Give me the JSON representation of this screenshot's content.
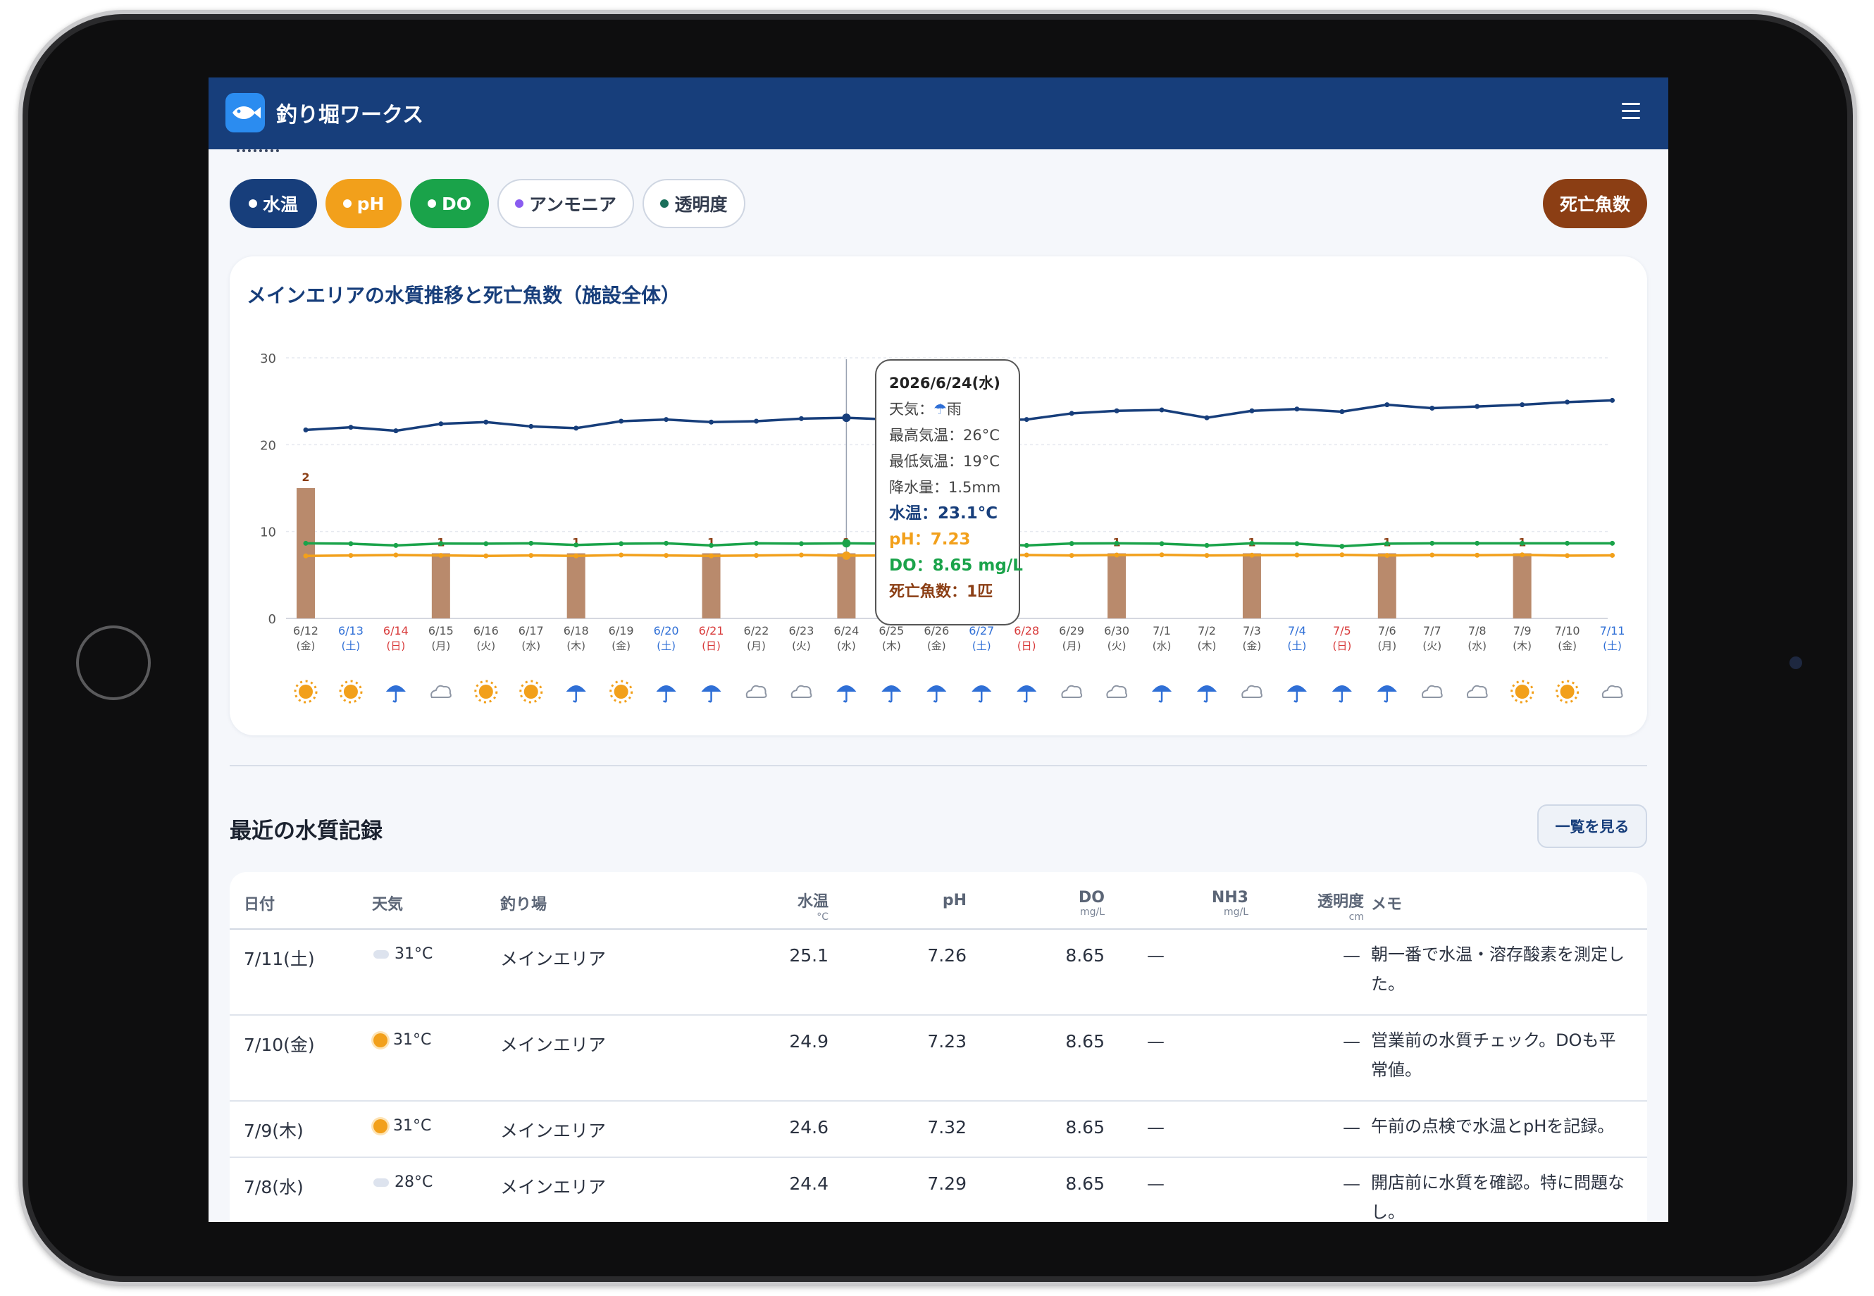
{
  "app": {
    "title": "釣り堀ワークス"
  },
  "chips": {
    "temp": "水温",
    "ph": "pH",
    "do": "DO",
    "nh3": "アンモニア",
    "clarity": "透明度",
    "dead": "死亡魚数"
  },
  "chart_card": {
    "title": "メインエリアの水質推移と死亡魚数（施設全体）"
  },
  "colors": {
    "temp": "#173e7b",
    "ph": "#f2a01b",
    "do": "#1aa34a",
    "dead": "#b98a6c",
    "dead_label": "#8b3e14",
    "saturday": "#2f6fd6",
    "sunday": "#d83a3a",
    "rain": "#2f6fd6",
    "sun": "#f2a01b"
  },
  "chart_data": {
    "type": "line",
    "title": "メインエリアの水質推移と死亡魚数（施設全体）",
    "ylim": [
      0,
      30
    ],
    "yticks": [
      0,
      10,
      20,
      30
    ],
    "grid": true,
    "categories": [
      "6/12",
      "6/13",
      "6/14",
      "6/15",
      "6/16",
      "6/17",
      "6/18",
      "6/19",
      "6/20",
      "6/21",
      "6/22",
      "6/23",
      "6/24",
      "6/25",
      "6/26",
      "6/27",
      "6/28",
      "6/29",
      "6/30",
      "7/1",
      "7/2",
      "7/3",
      "7/4",
      "7/5",
      "7/6",
      "7/7",
      "7/8",
      "7/9",
      "7/10",
      "7/11"
    ],
    "weekdays": [
      "(金)",
      "(土)",
      "(日)",
      "(月)",
      "(火)",
      "(水)",
      "(木)",
      "(金)",
      "(土)",
      "(日)",
      "(月)",
      "(火)",
      "(水)",
      "(木)",
      "(金)",
      "(土)",
      "(日)",
      "(月)",
      "(火)",
      "(水)",
      "(木)",
      "(金)",
      "(土)",
      "(日)",
      "(月)",
      "(火)",
      "(水)",
      "(木)",
      "(金)",
      "(土)"
    ],
    "weather": [
      "sun",
      "sun",
      "rain",
      "cloud",
      "sun",
      "sun",
      "rain",
      "sun",
      "rain",
      "rain",
      "cloud",
      "cloud",
      "rain",
      "rain",
      "rain",
      "rain",
      "rain",
      "cloud",
      "cloud",
      "rain",
      "rain",
      "cloud",
      "rain",
      "rain",
      "rain",
      "cloud",
      "cloud",
      "sun",
      "sun",
      "cloud"
    ],
    "series": [
      {
        "name": "水温",
        "type": "line",
        "values": [
          21.7,
          22.0,
          21.6,
          22.4,
          22.6,
          22.1,
          21.9,
          22.7,
          22.9,
          22.6,
          22.7,
          23.0,
          23.1,
          22.9,
          23.0,
          22.8,
          22.9,
          23.6,
          23.9,
          24.0,
          23.1,
          23.9,
          24.1,
          23.8,
          24.6,
          24.2,
          24.4,
          24.6,
          24.9,
          25.1
        ]
      },
      {
        "name": "DO",
        "type": "line",
        "values": [
          8.65,
          8.6,
          8.4,
          8.62,
          8.6,
          8.65,
          8.45,
          8.6,
          8.65,
          8.4,
          8.65,
          8.6,
          8.65,
          8.6,
          8.65,
          8.62,
          8.4,
          8.62,
          8.65,
          8.6,
          8.4,
          8.65,
          8.6,
          8.3,
          8.6,
          8.65,
          8.65,
          8.65,
          8.65,
          8.65
        ]
      },
      {
        "name": "pH",
        "type": "line",
        "values": [
          7.2,
          7.25,
          7.3,
          7.25,
          7.2,
          7.25,
          7.2,
          7.3,
          7.25,
          7.2,
          7.25,
          7.3,
          7.23,
          7.25,
          7.2,
          7.25,
          7.3,
          7.25,
          7.3,
          7.32,
          7.25,
          7.28,
          7.3,
          7.32,
          7.25,
          7.3,
          7.28,
          7.32,
          7.23,
          7.26
        ]
      },
      {
        "name": "死亡魚数",
        "type": "bar",
        "values": [
          2,
          0,
          0,
          1,
          0,
          0,
          1,
          0,
          0,
          1,
          0,
          0,
          1,
          0,
          0,
          0,
          0,
          0,
          1,
          0,
          0,
          1,
          0,
          0,
          1,
          0,
          0,
          1,
          0,
          0
        ]
      }
    ],
    "dead_scale_note": "死亡魚数 bars share the left axis scaled x7.5"
  },
  "tooltip": {
    "date": "2026/6/24(水)",
    "weather_label": "天気：",
    "weather_icon": "umbrella-icon",
    "weather_text": "雨",
    "max_temp": "最高気温：26°C",
    "min_temp": "最低気温：19°C",
    "rain": "降水量：1.5mm",
    "water_temp": "水温：23.1°C",
    "ph": "pH：7.23",
    "do": "DO：8.65 mg/L",
    "dead": "死亡魚数：1匹"
  },
  "records": {
    "title": "最近の水質記録",
    "view_all": "一覧を見る",
    "headers": {
      "date": "日付",
      "weather": "天気",
      "spot": "釣り場",
      "temp": "水温",
      "temp_unit": "°C",
      "ph": "pH",
      "do": "DO",
      "do_unit": "mg/L",
      "nh3": "NH3",
      "nh3_unit": "mg/L",
      "clarity": "透明度",
      "clarity_unit": "cm",
      "memo": "メモ"
    },
    "rows": [
      {
        "date": "7/11(土)",
        "weather": "cloud",
        "temp_c": "31°C",
        "spot": "メインエリア",
        "water_temp": "25.1",
        "ph": "7.26",
        "do": "8.65",
        "nh3": "—",
        "clarity": "—",
        "memo": "朝一番で水温・溶存酸素を測定した。"
      },
      {
        "date": "7/10(金)",
        "weather": "sun",
        "temp_c": "31°C",
        "spot": "メインエリア",
        "water_temp": "24.9",
        "ph": "7.23",
        "do": "8.65",
        "nh3": "—",
        "clarity": "—",
        "memo": "営業前の水質チェック。DOも平常値。"
      },
      {
        "date": "7/9(木)",
        "weather": "sun",
        "temp_c": "31°C",
        "spot": "メインエリア",
        "water_temp": "24.6",
        "ph": "7.32",
        "do": "8.65",
        "nh3": "—",
        "clarity": "—",
        "memo": "午前の点検で水温とpHを記録。"
      },
      {
        "date": "7/8(水)",
        "weather": "cloud",
        "temp_c": "28°C",
        "spot": "メインエリア",
        "water_temp": "24.4",
        "ph": "7.29",
        "do": "8.65",
        "nh3": "—",
        "clarity": "—",
        "memo": "開店前に水質を確認。特に問題なし。"
      }
    ]
  }
}
